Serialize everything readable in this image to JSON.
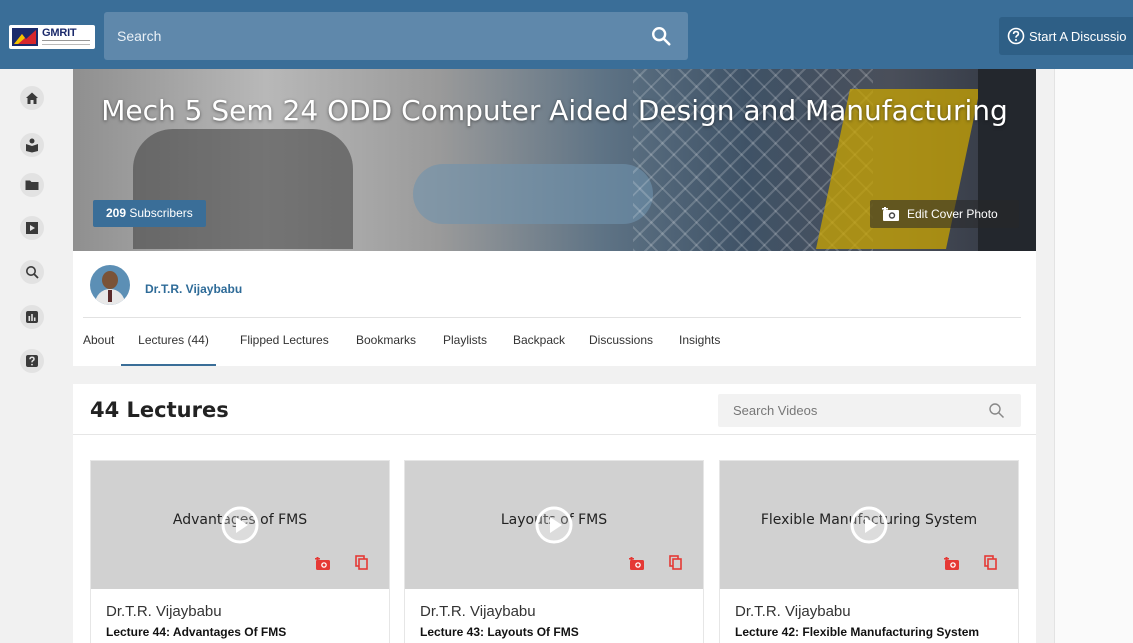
{
  "header": {
    "logo_text": "GMRIT",
    "search_placeholder": "Search",
    "start_discussion_label": "Start A Discussio"
  },
  "sidebar": {
    "icons": [
      "home-icon",
      "learner-icon",
      "folder-icon",
      "play-video-icon",
      "search-icon",
      "insights-icon",
      "help-icon"
    ]
  },
  "channel": {
    "title": "Mech 5 Sem 24 ODD Computer Aided Design and Manufacturing",
    "subscribers_count": "209",
    "subscribers_label": "Subscribers",
    "edit_cover_label": "Edit Cover Photo",
    "owner_name": "Dr.T.R. Vijaybabu"
  },
  "tabs": [
    {
      "label": "About",
      "active": false
    },
    {
      "label": "Lectures (44)",
      "active": true
    },
    {
      "label": "Flipped Lectures",
      "active": false
    },
    {
      "label": "Bookmarks",
      "active": false
    },
    {
      "label": "Playlists",
      "active": false
    },
    {
      "label": "Backpack",
      "active": false
    },
    {
      "label": "Discussions",
      "active": false
    },
    {
      "label": "Insights",
      "active": false
    }
  ],
  "lectures": {
    "heading": "44 Lectures",
    "search_placeholder": "Search Videos",
    "cards": [
      {
        "thumb_title": "Advantages of FMS",
        "author": "Dr.T.R. Vijaybabu",
        "lecture": "Lecture 44: Advantages Of FMS"
      },
      {
        "thumb_title": "Layouts of FMS",
        "author": "Dr.T.R. Vijaybabu",
        "lecture": "Lecture 43: Layouts Of FMS"
      },
      {
        "thumb_title": "Flexible Manufacturing System",
        "author": "Dr.T.R. Vijaybabu",
        "lecture": "Lecture 42: Flexible Manufacturing System"
      }
    ]
  },
  "colors": {
    "header_bg": "#3a6e98",
    "accent_link": "#2e6b98",
    "action_red": "#e53935"
  }
}
